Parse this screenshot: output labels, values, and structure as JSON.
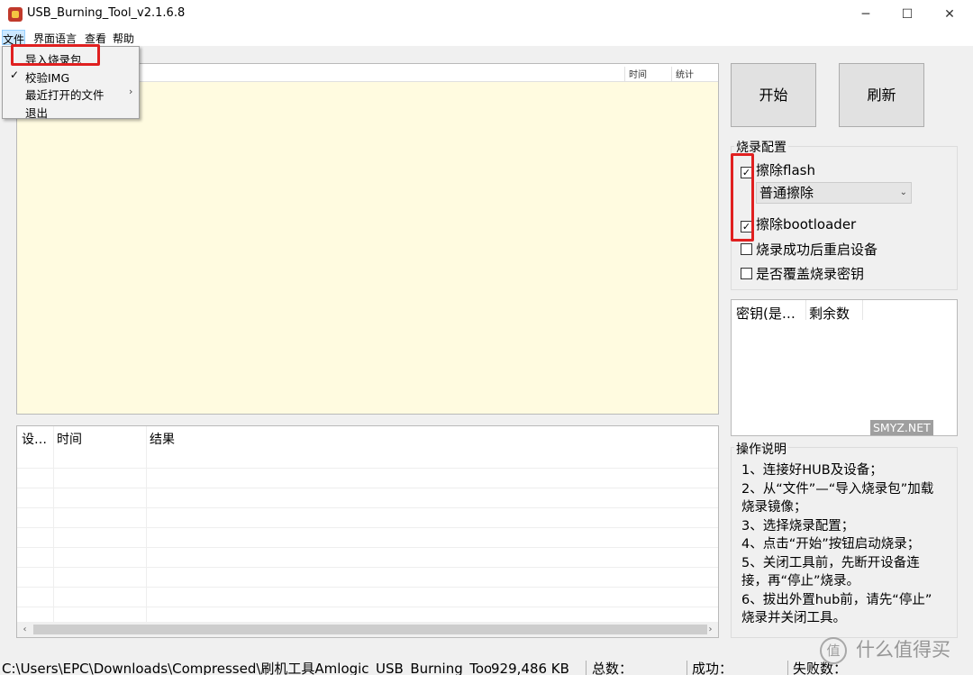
{
  "window": {
    "title": "USB_Burning_Tool_v2.1.6.8",
    "minimize": "─",
    "maximize": "☐",
    "close": "✕"
  },
  "menubar": {
    "items": [
      "文件",
      "界面语言",
      "查看",
      "帮助"
    ]
  },
  "file_menu": {
    "items": [
      {
        "label": "导入烧录包",
        "checked": false
      },
      {
        "label": "校验IMG",
        "checked": true,
        "check": "✓"
      },
      {
        "label": "最近打开的文件",
        "submenu_arrow": "›"
      },
      {
        "label": "退出"
      }
    ]
  },
  "device_table": {
    "headers": [
      "时间",
      "统计"
    ]
  },
  "log_table": {
    "headers": [
      "设…",
      "时间",
      "结果"
    ],
    "scroll_left": "‹",
    "scroll_right": "›"
  },
  "buttons": {
    "start": "开始",
    "refresh": "刷新"
  },
  "burn_config": {
    "title": "烧录配置",
    "erase_flash": {
      "label": "擦除flash",
      "checked": true
    },
    "erase_mode": {
      "value": "普通擦除",
      "arrow": "⌄"
    },
    "erase_bootloader": {
      "label": "擦除bootloader",
      "checked": true
    },
    "reboot_after": {
      "label": "烧录成功后重启设备",
      "checked": false
    },
    "overwrite_key": {
      "label": "是否覆盖烧录密钥",
      "checked": false
    },
    "check_mark": "☑"
  },
  "keys_table": {
    "headers": [
      "密钥(是…",
      "剩余数"
    ]
  },
  "instructions": {
    "title": "操作说明",
    "lines": [
      "1、连接好HUB及设备；",
      "2、从“文件”—“导入烧录包”加载",
      "烧录镜像；",
      "3、选择烧录配置；",
      "4、点击“开始”按钮启动烧录；",
      "5、关闭工具前，先断开设备连",
      "接，再“停止”烧录。",
      "6、拔出外置hub前，请先“停止”",
      "烧录并关闭工具。"
    ]
  },
  "statusbar": {
    "path": "C:\\Users\\EPC\\Downloads\\Compressed\\刷机工具Amlogic_USB_Burning_Too",
    "size": "929,486 KB",
    "total": "总数：",
    "success": "成功：",
    "failed": "失败数："
  },
  "watermark": {
    "badge": "值",
    "text": "什么值得买",
    "site": "SMYZ.NET"
  },
  "colors": {
    "yellow_panel": "#fffbe0",
    "highlight": "#e02020",
    "menu_active": "#cce8ff"
  }
}
